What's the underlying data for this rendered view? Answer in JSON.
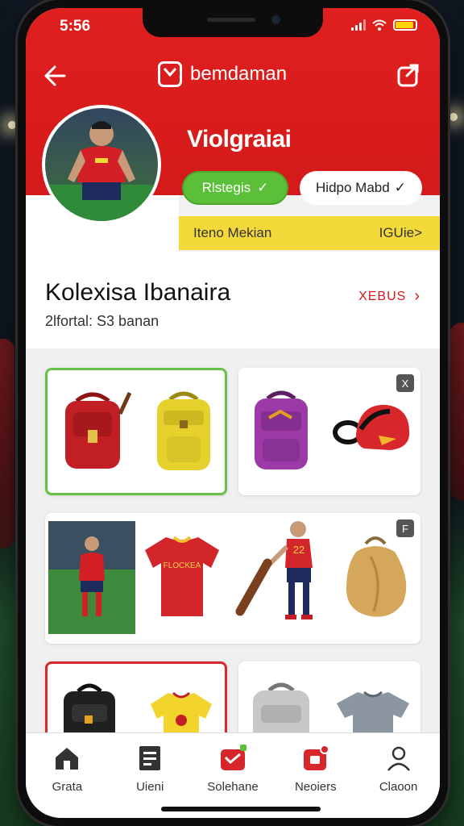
{
  "status_bar": {
    "time": "5:56"
  },
  "header": {
    "brand": "bemdaman",
    "profile_name": "Violgraiai",
    "follow_button": "Rlstegis",
    "follow_glyph": "✓",
    "message_button": "Hidpo Mabd",
    "message_glyph": "✓",
    "banner_left": "Iteno Mekian",
    "banner_right": "IGUie>"
  },
  "collection": {
    "title": "Kolexisa Ibanaira",
    "subtitle": "2lfortal: S3 banan",
    "link": "XEBUS",
    "link_glyph": "›"
  },
  "products": {
    "tag_1": "X",
    "tag_2": "F",
    "jersey_text": "FLOCKEA",
    "player_number": "22"
  },
  "tabs": [
    {
      "label": "Grata",
      "icon": "home-icon"
    },
    {
      "label": "Uieni",
      "icon": "document-icon"
    },
    {
      "label": "Solehane",
      "icon": "shop-bag-icon"
    },
    {
      "label": "Neoiers",
      "icon": "notification-icon"
    },
    {
      "label": "Claoon",
      "icon": "profile-icon"
    }
  ],
  "colors": {
    "brand_red": "#d41a1a",
    "accent_green": "#5bbf3a",
    "accent_yellow": "#f4d93a"
  }
}
